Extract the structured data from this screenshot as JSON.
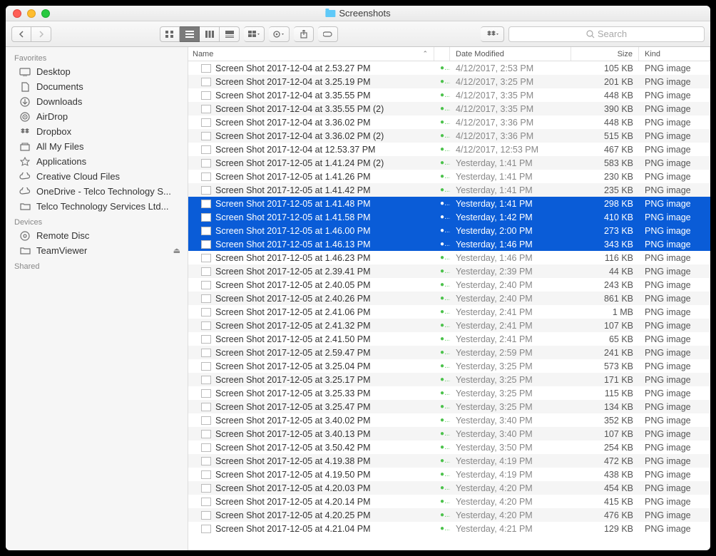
{
  "window": {
    "title": "Screenshots"
  },
  "search": {
    "placeholder": "Search"
  },
  "sidebar": {
    "sections": [
      {
        "label": "Favorites",
        "items": [
          {
            "icon": "desktop",
            "label": "Desktop"
          },
          {
            "icon": "document",
            "label": "Documents"
          },
          {
            "icon": "download",
            "label": "Downloads"
          },
          {
            "icon": "airdrop",
            "label": "AirDrop"
          },
          {
            "icon": "dropbox",
            "label": "Dropbox"
          },
          {
            "icon": "allfiles",
            "label": "All My Files"
          },
          {
            "icon": "apps",
            "label": "Applications"
          },
          {
            "icon": "cloud",
            "label": "Creative Cloud Files"
          },
          {
            "icon": "cloud",
            "label": "OneDrive - Telco Technology S..."
          },
          {
            "icon": "folder",
            "label": "Telco Technology Services Ltd..."
          }
        ]
      },
      {
        "label": "Devices",
        "items": [
          {
            "icon": "disc",
            "label": "Remote Disc"
          },
          {
            "icon": "folder",
            "label": "TeamViewer",
            "eject": true
          }
        ]
      },
      {
        "label": "Shared",
        "items": []
      }
    ]
  },
  "columns": {
    "name": "Name",
    "date": "Date Modified",
    "size": "Size",
    "kind": "Kind"
  },
  "files": [
    {
      "name": "Screen Shot 2017-12-04 at 2.53.27 PM",
      "date": "4/12/2017, 2:53 PM",
      "size": "105 KB",
      "kind": "PNG image",
      "selected": false
    },
    {
      "name": "Screen Shot 2017-12-04 at 3.25.19 PM",
      "date": "4/12/2017, 3:25 PM",
      "size": "201 KB",
      "kind": "PNG image",
      "selected": false
    },
    {
      "name": "Screen Shot 2017-12-04 at 3.35.55 PM",
      "date": "4/12/2017, 3:35 PM",
      "size": "448 KB",
      "kind": "PNG image",
      "selected": false
    },
    {
      "name": "Screen Shot 2017-12-04 at 3.35.55 PM (2)",
      "date": "4/12/2017, 3:35 PM",
      "size": "390 KB",
      "kind": "PNG image",
      "selected": false
    },
    {
      "name": "Screen Shot 2017-12-04 at 3.36.02 PM",
      "date": "4/12/2017, 3:36 PM",
      "size": "448 KB",
      "kind": "PNG image",
      "selected": false
    },
    {
      "name": "Screen Shot 2017-12-04 at 3.36.02 PM (2)",
      "date": "4/12/2017, 3:36 PM",
      "size": "515 KB",
      "kind": "PNG image",
      "selected": false
    },
    {
      "name": "Screen Shot 2017-12-04 at 12.53.37 PM",
      "date": "4/12/2017, 12:53 PM",
      "size": "467 KB",
      "kind": "PNG image",
      "selected": false
    },
    {
      "name": "Screen Shot 2017-12-05 at 1.41.24 PM (2)",
      "date": "Yesterday, 1:41 PM",
      "size": "583 KB",
      "kind": "PNG image",
      "selected": false
    },
    {
      "name": "Screen Shot 2017-12-05 at 1.41.26 PM",
      "date": "Yesterday, 1:41 PM",
      "size": "230 KB",
      "kind": "PNG image",
      "selected": false
    },
    {
      "name": "Screen Shot 2017-12-05 at 1.41.42 PM",
      "date": "Yesterday, 1:41 PM",
      "size": "235 KB",
      "kind": "PNG image",
      "selected": false
    },
    {
      "name": "Screen Shot 2017-12-05 at 1.41.48 PM",
      "date": "Yesterday, 1:41 PM",
      "size": "298 KB",
      "kind": "PNG image",
      "selected": true
    },
    {
      "name": "Screen Shot 2017-12-05 at 1.41.58 PM",
      "date": "Yesterday, 1:42 PM",
      "size": "410 KB",
      "kind": "PNG image",
      "selected": true
    },
    {
      "name": "Screen Shot 2017-12-05 at 1.46.00 PM",
      "date": "Yesterday, 2:00 PM",
      "size": "273 KB",
      "kind": "PNG image",
      "selected": true
    },
    {
      "name": "Screen Shot 2017-12-05 at 1.46.13 PM",
      "date": "Yesterday, 1:46 PM",
      "size": "343 KB",
      "kind": "PNG image",
      "selected": true
    },
    {
      "name": "Screen Shot 2017-12-05 at 1.46.23 PM",
      "date": "Yesterday, 1:46 PM",
      "size": "116 KB",
      "kind": "PNG image",
      "selected": false
    },
    {
      "name": "Screen Shot 2017-12-05 at 2.39.41 PM",
      "date": "Yesterday, 2:39 PM",
      "size": "44 KB",
      "kind": "PNG image",
      "selected": false
    },
    {
      "name": "Screen Shot 2017-12-05 at 2.40.05 PM",
      "date": "Yesterday, 2:40 PM",
      "size": "243 KB",
      "kind": "PNG image",
      "selected": false
    },
    {
      "name": "Screen Shot 2017-12-05 at 2.40.26 PM",
      "date": "Yesterday, 2:40 PM",
      "size": "861 KB",
      "kind": "PNG image",
      "selected": false
    },
    {
      "name": "Screen Shot 2017-12-05 at 2.41.06 PM",
      "date": "Yesterday, 2:41 PM",
      "size": "1 MB",
      "kind": "PNG image",
      "selected": false
    },
    {
      "name": "Screen Shot 2017-12-05 at 2.41.32 PM",
      "date": "Yesterday, 2:41 PM",
      "size": "107 KB",
      "kind": "PNG image",
      "selected": false
    },
    {
      "name": "Screen Shot 2017-12-05 at 2.41.50 PM",
      "date": "Yesterday, 2:41 PM",
      "size": "65 KB",
      "kind": "PNG image",
      "selected": false
    },
    {
      "name": "Screen Shot 2017-12-05 at 2.59.47 PM",
      "date": "Yesterday, 2:59 PM",
      "size": "241 KB",
      "kind": "PNG image",
      "selected": false
    },
    {
      "name": "Screen Shot 2017-12-05 at 3.25.04 PM",
      "date": "Yesterday, 3:25 PM",
      "size": "573 KB",
      "kind": "PNG image",
      "selected": false
    },
    {
      "name": "Screen Shot 2017-12-05 at 3.25.17 PM",
      "date": "Yesterday, 3:25 PM",
      "size": "171 KB",
      "kind": "PNG image",
      "selected": false
    },
    {
      "name": "Screen Shot 2017-12-05 at 3.25.33 PM",
      "date": "Yesterday, 3:25 PM",
      "size": "115 KB",
      "kind": "PNG image",
      "selected": false
    },
    {
      "name": "Screen Shot 2017-12-05 at 3.25.47 PM",
      "date": "Yesterday, 3:25 PM",
      "size": "134 KB",
      "kind": "PNG image",
      "selected": false
    },
    {
      "name": "Screen Shot 2017-12-05 at 3.40.02 PM",
      "date": "Yesterday, 3:40 PM",
      "size": "352 KB",
      "kind": "PNG image",
      "selected": false
    },
    {
      "name": "Screen Shot 2017-12-05 at 3.40.13 PM",
      "date": "Yesterday, 3:40 PM",
      "size": "107 KB",
      "kind": "PNG image",
      "selected": false
    },
    {
      "name": "Screen Shot 2017-12-05 at 3.50.42 PM",
      "date": "Yesterday, 3:50 PM",
      "size": "254 KB",
      "kind": "PNG image",
      "selected": false
    },
    {
      "name": "Screen Shot 2017-12-05 at 4.19.38 PM",
      "date": "Yesterday, 4:19 PM",
      "size": "472 KB",
      "kind": "PNG image",
      "selected": false
    },
    {
      "name": "Screen Shot 2017-12-05 at 4.19.50 PM",
      "date": "Yesterday, 4:19 PM",
      "size": "438 KB",
      "kind": "PNG image",
      "selected": false
    },
    {
      "name": "Screen Shot 2017-12-05 at 4.20.03 PM",
      "date": "Yesterday, 4:20 PM",
      "size": "454 KB",
      "kind": "PNG image",
      "selected": false
    },
    {
      "name": "Screen Shot 2017-12-05 at 4.20.14 PM",
      "date": "Yesterday, 4:20 PM",
      "size": "415 KB",
      "kind": "PNG image",
      "selected": false
    },
    {
      "name": "Screen Shot 2017-12-05 at 4.20.25 PM",
      "date": "Yesterday, 4:20 PM",
      "size": "476 KB",
      "kind": "PNG image",
      "selected": false
    },
    {
      "name": "Screen Shot 2017-12-05 at 4.21.04 PM",
      "date": "Yesterday, 4:21 PM",
      "size": "129 KB",
      "kind": "PNG image",
      "selected": false
    }
  ]
}
